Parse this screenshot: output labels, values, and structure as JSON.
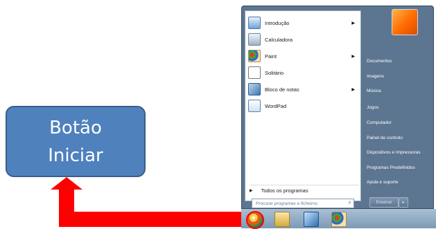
{
  "callout": {
    "line1": "Botão",
    "line2": "Iniciar"
  },
  "start_menu": {
    "programs": [
      {
        "label": "Introdução",
        "icon": "getting-started-icon",
        "submenu": true
      },
      {
        "label": "Calculadora",
        "icon": "calculator-icon",
        "submenu": false
      },
      {
        "label": "Paint",
        "icon": "paint-icon",
        "submenu": true
      },
      {
        "label": "Solitário",
        "icon": "solitaire-icon",
        "submenu": false
      },
      {
        "label": "Bloco de notas",
        "icon": "notepad-icon",
        "submenu": true
      },
      {
        "label": "WordPad",
        "icon": "wordpad-icon",
        "submenu": false
      }
    ],
    "all_programs_label": "Todos os programas",
    "search_placeholder": "Procurar programas e ficheiros",
    "right_links": [
      "Documentos",
      "Imagens",
      "Música",
      "Jogos",
      "Computador",
      "Painel de controlo",
      "Dispositivos e Impressoras",
      "Programas Predefinidos",
      "Ajuda e suporte"
    ],
    "shutdown_label": "Encerrar",
    "shutdown_arrow": "▸"
  },
  "taskbar": {
    "pinned": [
      "start-orb",
      "explorer-icon",
      "media-player-icon",
      "paint-icon"
    ]
  },
  "colors": {
    "callout_fill": "#4f81bd",
    "arrow": "#ff0000",
    "menu_right_pane": "#5c7590"
  }
}
